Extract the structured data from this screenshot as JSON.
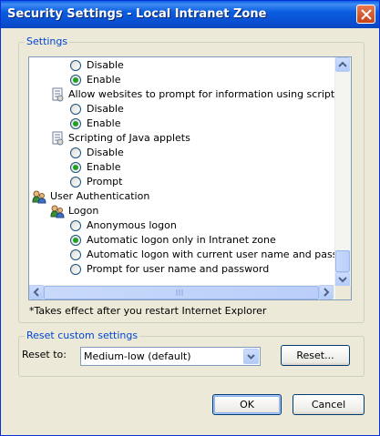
{
  "window": {
    "title": "Security Settings - Local Intranet Zone"
  },
  "settings_group": {
    "legend": "Settings"
  },
  "settings_list": [
    {
      "kind": "radio",
      "label": "Disable",
      "checked": false
    },
    {
      "kind": "radio",
      "label": "Enable",
      "checked": true
    },
    {
      "kind": "heading",
      "label": "Allow websites to prompt for information using scripted windo",
      "icon": "script-settings-icon"
    },
    {
      "kind": "radio",
      "label": "Disable",
      "checked": false
    },
    {
      "kind": "radio",
      "label": "Enable",
      "checked": true
    },
    {
      "kind": "heading",
      "label": "Scripting of Java applets",
      "icon": "script-settings-icon"
    },
    {
      "kind": "radio",
      "label": "Disable",
      "checked": false
    },
    {
      "kind": "radio",
      "label": "Enable",
      "checked": true
    },
    {
      "kind": "radio",
      "label": "Prompt",
      "checked": false
    },
    {
      "kind": "category",
      "label": "User Authentication",
      "icon": "users-icon"
    },
    {
      "kind": "heading",
      "label": "Logon",
      "icon": "users-icon"
    },
    {
      "kind": "radio",
      "label": "Anonymous logon",
      "checked": false
    },
    {
      "kind": "radio",
      "label": "Automatic logon only in Intranet zone",
      "checked": true
    },
    {
      "kind": "radio",
      "label": "Automatic logon with current user name and password",
      "checked": false
    },
    {
      "kind": "radio",
      "label": "Prompt for user name and password",
      "checked": false
    }
  ],
  "note": "*Takes effect after you restart Internet Explorer",
  "reset_group": {
    "legend": "Reset custom settings",
    "reset_to_label": "Reset to:",
    "reset_to_value": "Medium-low (default)",
    "reset_button": "Reset..."
  },
  "buttons": {
    "ok": "OK",
    "cancel": "Cancel"
  },
  "colors": {
    "title_bar": "#0a5fe8",
    "group_label": "#0046d5",
    "checked_radio": "#21a121",
    "face": "#ece9d8"
  }
}
